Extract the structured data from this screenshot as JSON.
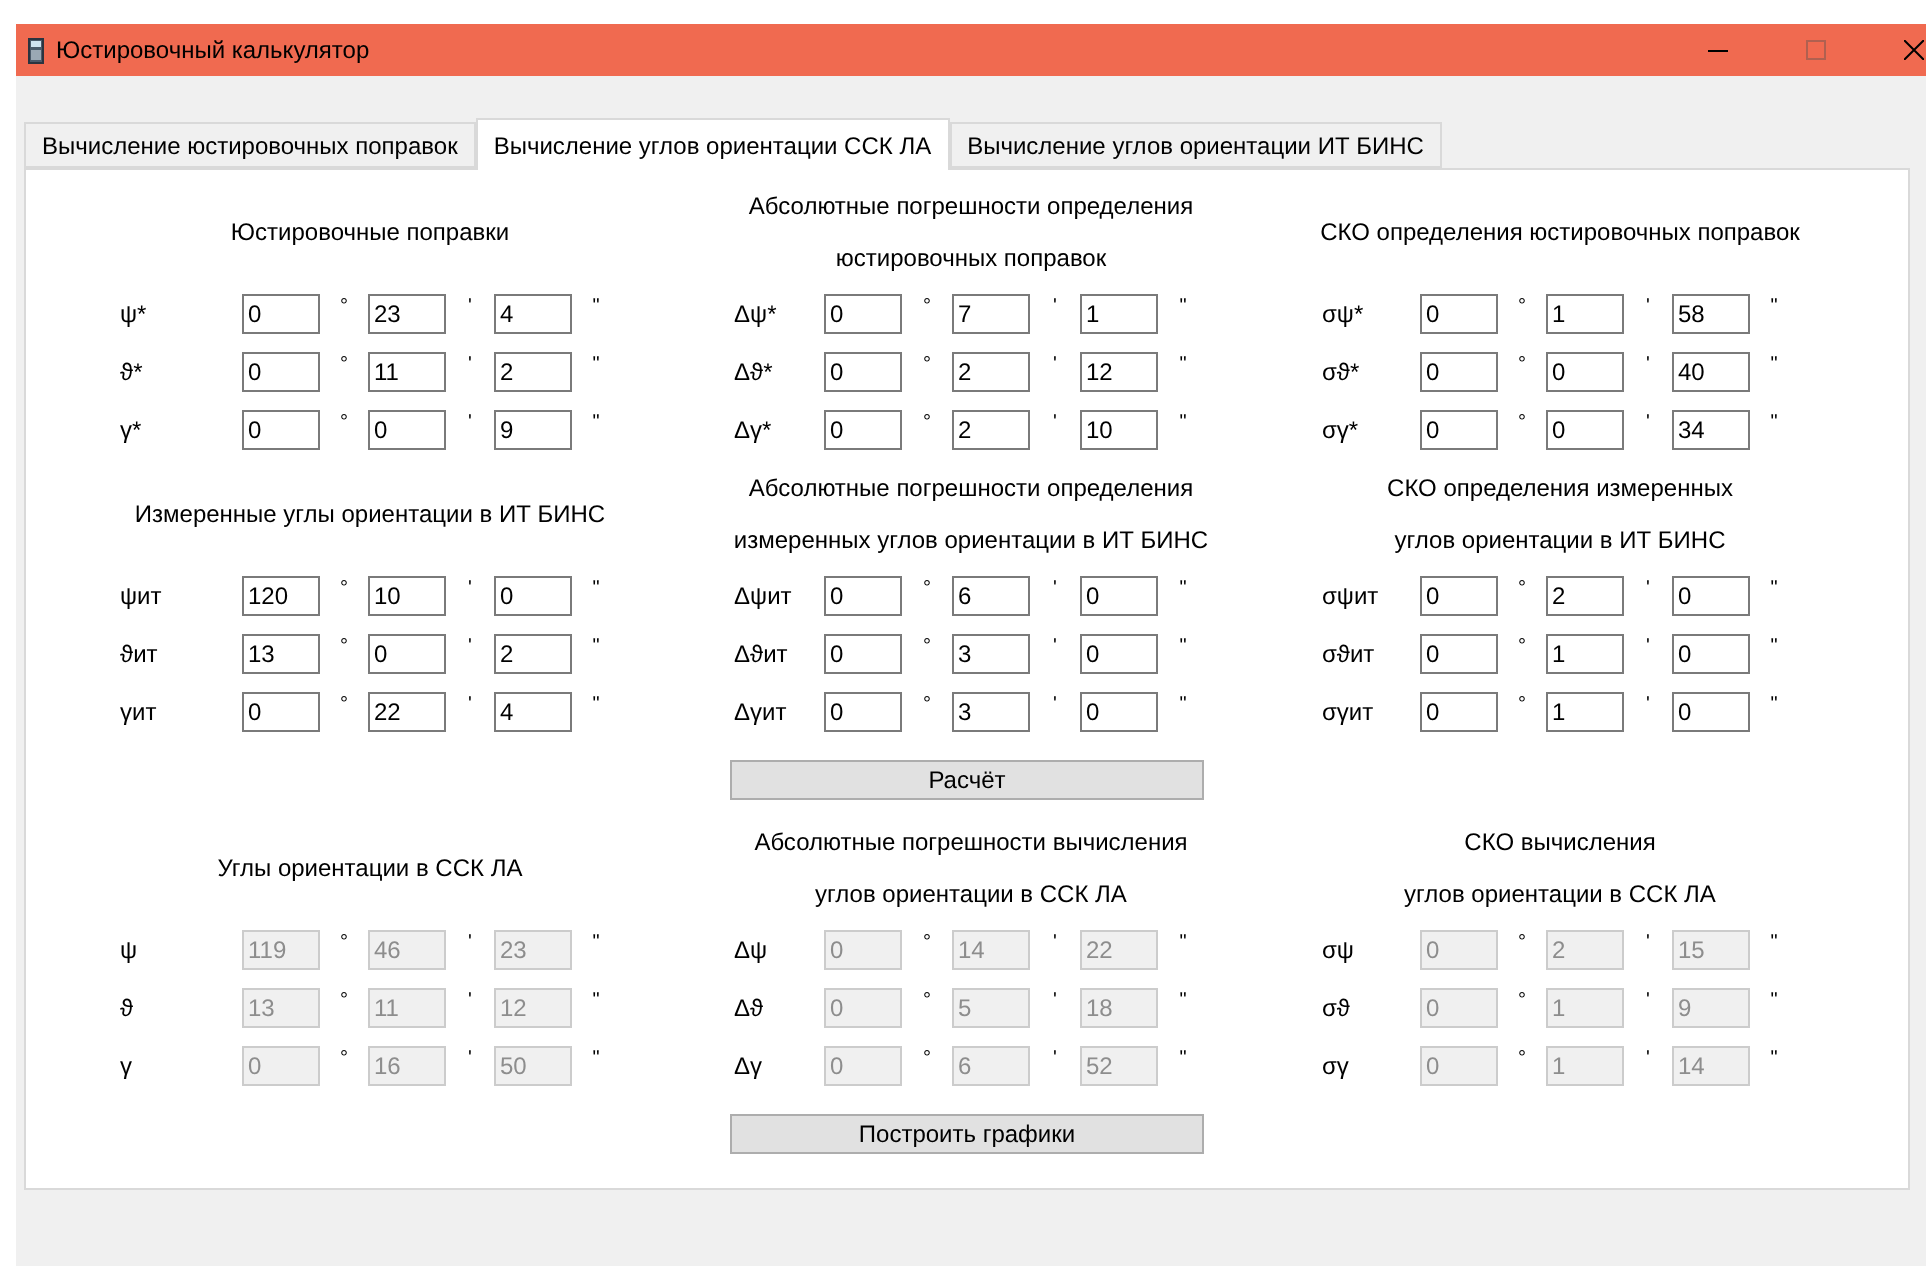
{
  "window": {
    "title": "Юстировочный калькулятор"
  },
  "tabs": [
    {
      "label": "Вычисление юстировочных поправок",
      "selected": false
    },
    {
      "label": "Вычисление углов ориентации ССК ЛА",
      "selected": true
    },
    {
      "label": "Вычисление углов ориентации ИТ БИНС",
      "selected": false
    }
  ],
  "sections": [
    {
      "blocks": [
        {
          "title_lines": [
            "Юстировочные поправки"
          ],
          "disabled": false,
          "rows": [
            {
              "label": "ψ*",
              "fields": [
                {
                  "value": "0",
                  "unit": "°"
                },
                {
                  "value": "23",
                  "unit": "'"
                },
                {
                  "value": "4",
                  "unit": "\""
                }
              ]
            },
            {
              "label": "ϑ*",
              "fields": [
                {
                  "value": "0",
                  "unit": "°"
                },
                {
                  "value": "11",
                  "unit": "'"
                },
                {
                  "value": "2",
                  "unit": "\""
                }
              ]
            },
            {
              "label": "γ*",
              "fields": [
                {
                  "value": "0",
                  "unit": "°"
                },
                {
                  "value": "0",
                  "unit": "'"
                },
                {
                  "value": "9",
                  "unit": "\""
                }
              ]
            }
          ]
        },
        {
          "title_lines": [
            "Абсолютные погрешности определения",
            "юстировочных поправок"
          ],
          "disabled": false,
          "rows": [
            {
              "label": "Δψ*",
              "fields": [
                {
                  "value": "0",
                  "unit": "°"
                },
                {
                  "value": "7",
                  "unit": "'"
                },
                {
                  "value": "1",
                  "unit": "\""
                }
              ]
            },
            {
              "label": "Δϑ*",
              "fields": [
                {
                  "value": "0",
                  "unit": "°"
                },
                {
                  "value": "2",
                  "unit": "'"
                },
                {
                  "value": "12",
                  "unit": "\""
                }
              ]
            },
            {
              "label": "Δγ*",
              "fields": [
                {
                  "value": "0",
                  "unit": "°"
                },
                {
                  "value": "2",
                  "unit": "'"
                },
                {
                  "value": "10",
                  "unit": "\""
                }
              ]
            }
          ]
        },
        {
          "title_lines": [
            "СКО определения юстировочных поправок"
          ],
          "disabled": false,
          "rows": [
            {
              "label": "σψ*",
              "fields": [
                {
                  "value": "0",
                  "unit": "°"
                },
                {
                  "value": "1",
                  "unit": "'"
                },
                {
                  "value": "58",
                  "unit": "\""
                }
              ]
            },
            {
              "label": "σϑ*",
              "fields": [
                {
                  "value": "0",
                  "unit": "°"
                },
                {
                  "value": "0",
                  "unit": "'"
                },
                {
                  "value": "40",
                  "unit": "\""
                }
              ]
            },
            {
              "label": "σγ*",
              "fields": [
                {
                  "value": "0",
                  "unit": "°"
                },
                {
                  "value": "0",
                  "unit": "'"
                },
                {
                  "value": "34",
                  "unit": "\""
                }
              ]
            }
          ]
        }
      ]
    },
    {
      "blocks": [
        {
          "title_lines": [
            "Измеренные углы ориентации в ИТ БИНС"
          ],
          "disabled": false,
          "rows": [
            {
              "label": "ψит",
              "fields": [
                {
                  "value": "120",
                  "unit": "°"
                },
                {
                  "value": "10",
                  "unit": "'"
                },
                {
                  "value": "0",
                  "unit": "\""
                }
              ]
            },
            {
              "label": "ϑит",
              "fields": [
                {
                  "value": "13",
                  "unit": "°"
                },
                {
                  "value": "0",
                  "unit": "'"
                },
                {
                  "value": "2",
                  "unit": "\""
                }
              ]
            },
            {
              "label": "γит",
              "fields": [
                {
                  "value": "0",
                  "unit": "°"
                },
                {
                  "value": "22",
                  "unit": "'"
                },
                {
                  "value": "4",
                  "unit": "\""
                }
              ]
            }
          ]
        },
        {
          "title_lines": [
            "Абсолютные погрешности определения",
            "измеренных углов ориентации в ИТ БИНС"
          ],
          "disabled": false,
          "rows": [
            {
              "label": "Δψит",
              "fields": [
                {
                  "value": "0",
                  "unit": "°"
                },
                {
                  "value": "6",
                  "unit": "'"
                },
                {
                  "value": "0",
                  "unit": "\""
                }
              ]
            },
            {
              "label": "Δϑит",
              "fields": [
                {
                  "value": "0",
                  "unit": "°"
                },
                {
                  "value": "3",
                  "unit": "'"
                },
                {
                  "value": "0",
                  "unit": "\""
                }
              ]
            },
            {
              "label": "Δγит",
              "fields": [
                {
                  "value": "0",
                  "unit": "°"
                },
                {
                  "value": "3",
                  "unit": "'"
                },
                {
                  "value": "0",
                  "unit": "\""
                }
              ]
            }
          ]
        },
        {
          "title_lines": [
            "СКО определения измеренных",
            "углов ориентации в ИТ БИНС"
          ],
          "disabled": false,
          "rows": [
            {
              "label": "σψит",
              "fields": [
                {
                  "value": "0",
                  "unit": "°"
                },
                {
                  "value": "2",
                  "unit": "'"
                },
                {
                  "value": "0",
                  "unit": "\""
                }
              ]
            },
            {
              "label": "σϑит",
              "fields": [
                {
                  "value": "0",
                  "unit": "°"
                },
                {
                  "value": "1",
                  "unit": "'"
                },
                {
                  "value": "0",
                  "unit": "\""
                }
              ]
            },
            {
              "label": "σγит",
              "fields": [
                {
                  "value": "0",
                  "unit": "°"
                },
                {
                  "value": "1",
                  "unit": "'"
                },
                {
                  "value": "0",
                  "unit": "\""
                }
              ]
            }
          ]
        }
      ],
      "button": "Расчёт"
    },
    {
      "blocks": [
        {
          "title_lines": [
            "Углы ориентации в ССК ЛА"
          ],
          "disabled": true,
          "rows": [
            {
              "label": "ψ",
              "fields": [
                {
                  "value": "119",
                  "unit": "°"
                },
                {
                  "value": "46",
                  "unit": "'"
                },
                {
                  "value": "23",
                  "unit": "\""
                }
              ]
            },
            {
              "label": "ϑ",
              "fields": [
                {
                  "value": "13",
                  "unit": "°"
                },
                {
                  "value": "11",
                  "unit": "'"
                },
                {
                  "value": "12",
                  "unit": "\""
                }
              ]
            },
            {
              "label": "γ",
              "fields": [
                {
                  "value": "0",
                  "unit": "°"
                },
                {
                  "value": "16",
                  "unit": "'"
                },
                {
                  "value": "50",
                  "unit": "\""
                }
              ]
            }
          ]
        },
        {
          "title_lines": [
            "Абсолютные погрешности вычисления",
            "углов ориентации в ССК ЛА"
          ],
          "disabled": true,
          "rows": [
            {
              "label": "Δψ",
              "fields": [
                {
                  "value": "0",
                  "unit": "°"
                },
                {
                  "value": "14",
                  "unit": "'"
                },
                {
                  "value": "22",
                  "unit": "\""
                }
              ]
            },
            {
              "label": "Δϑ",
              "fields": [
                {
                  "value": "0",
                  "unit": "°"
                },
                {
                  "value": "5",
                  "unit": "'"
                },
                {
                  "value": "18",
                  "unit": "\""
                }
              ]
            },
            {
              "label": "Δγ",
              "fields": [
                {
                  "value": "0",
                  "unit": "°"
                },
                {
                  "value": "6",
                  "unit": "'"
                },
                {
                  "value": "52",
                  "unit": "\""
                }
              ]
            }
          ]
        },
        {
          "title_lines": [
            "СКО вычисления",
            "углов ориентации в ССК ЛА"
          ],
          "disabled": true,
          "rows": [
            {
              "label": "σψ",
              "fields": [
                {
                  "value": "0",
                  "unit": "°"
                },
                {
                  "value": "2",
                  "unit": "'"
                },
                {
                  "value": "15",
                  "unit": "\""
                }
              ]
            },
            {
              "label": "σϑ",
              "fields": [
                {
                  "value": "0",
                  "unit": "°"
                },
                {
                  "value": "1",
                  "unit": "'"
                },
                {
                  "value": "9",
                  "unit": "\""
                }
              ]
            },
            {
              "label": "σγ",
              "fields": [
                {
                  "value": "0",
                  "unit": "°"
                },
                {
                  "value": "1",
                  "unit": "'"
                },
                {
                  "value": "14",
                  "unit": "\""
                }
              ]
            }
          ]
        }
      ],
      "button": "Построить графики"
    }
  ]
}
